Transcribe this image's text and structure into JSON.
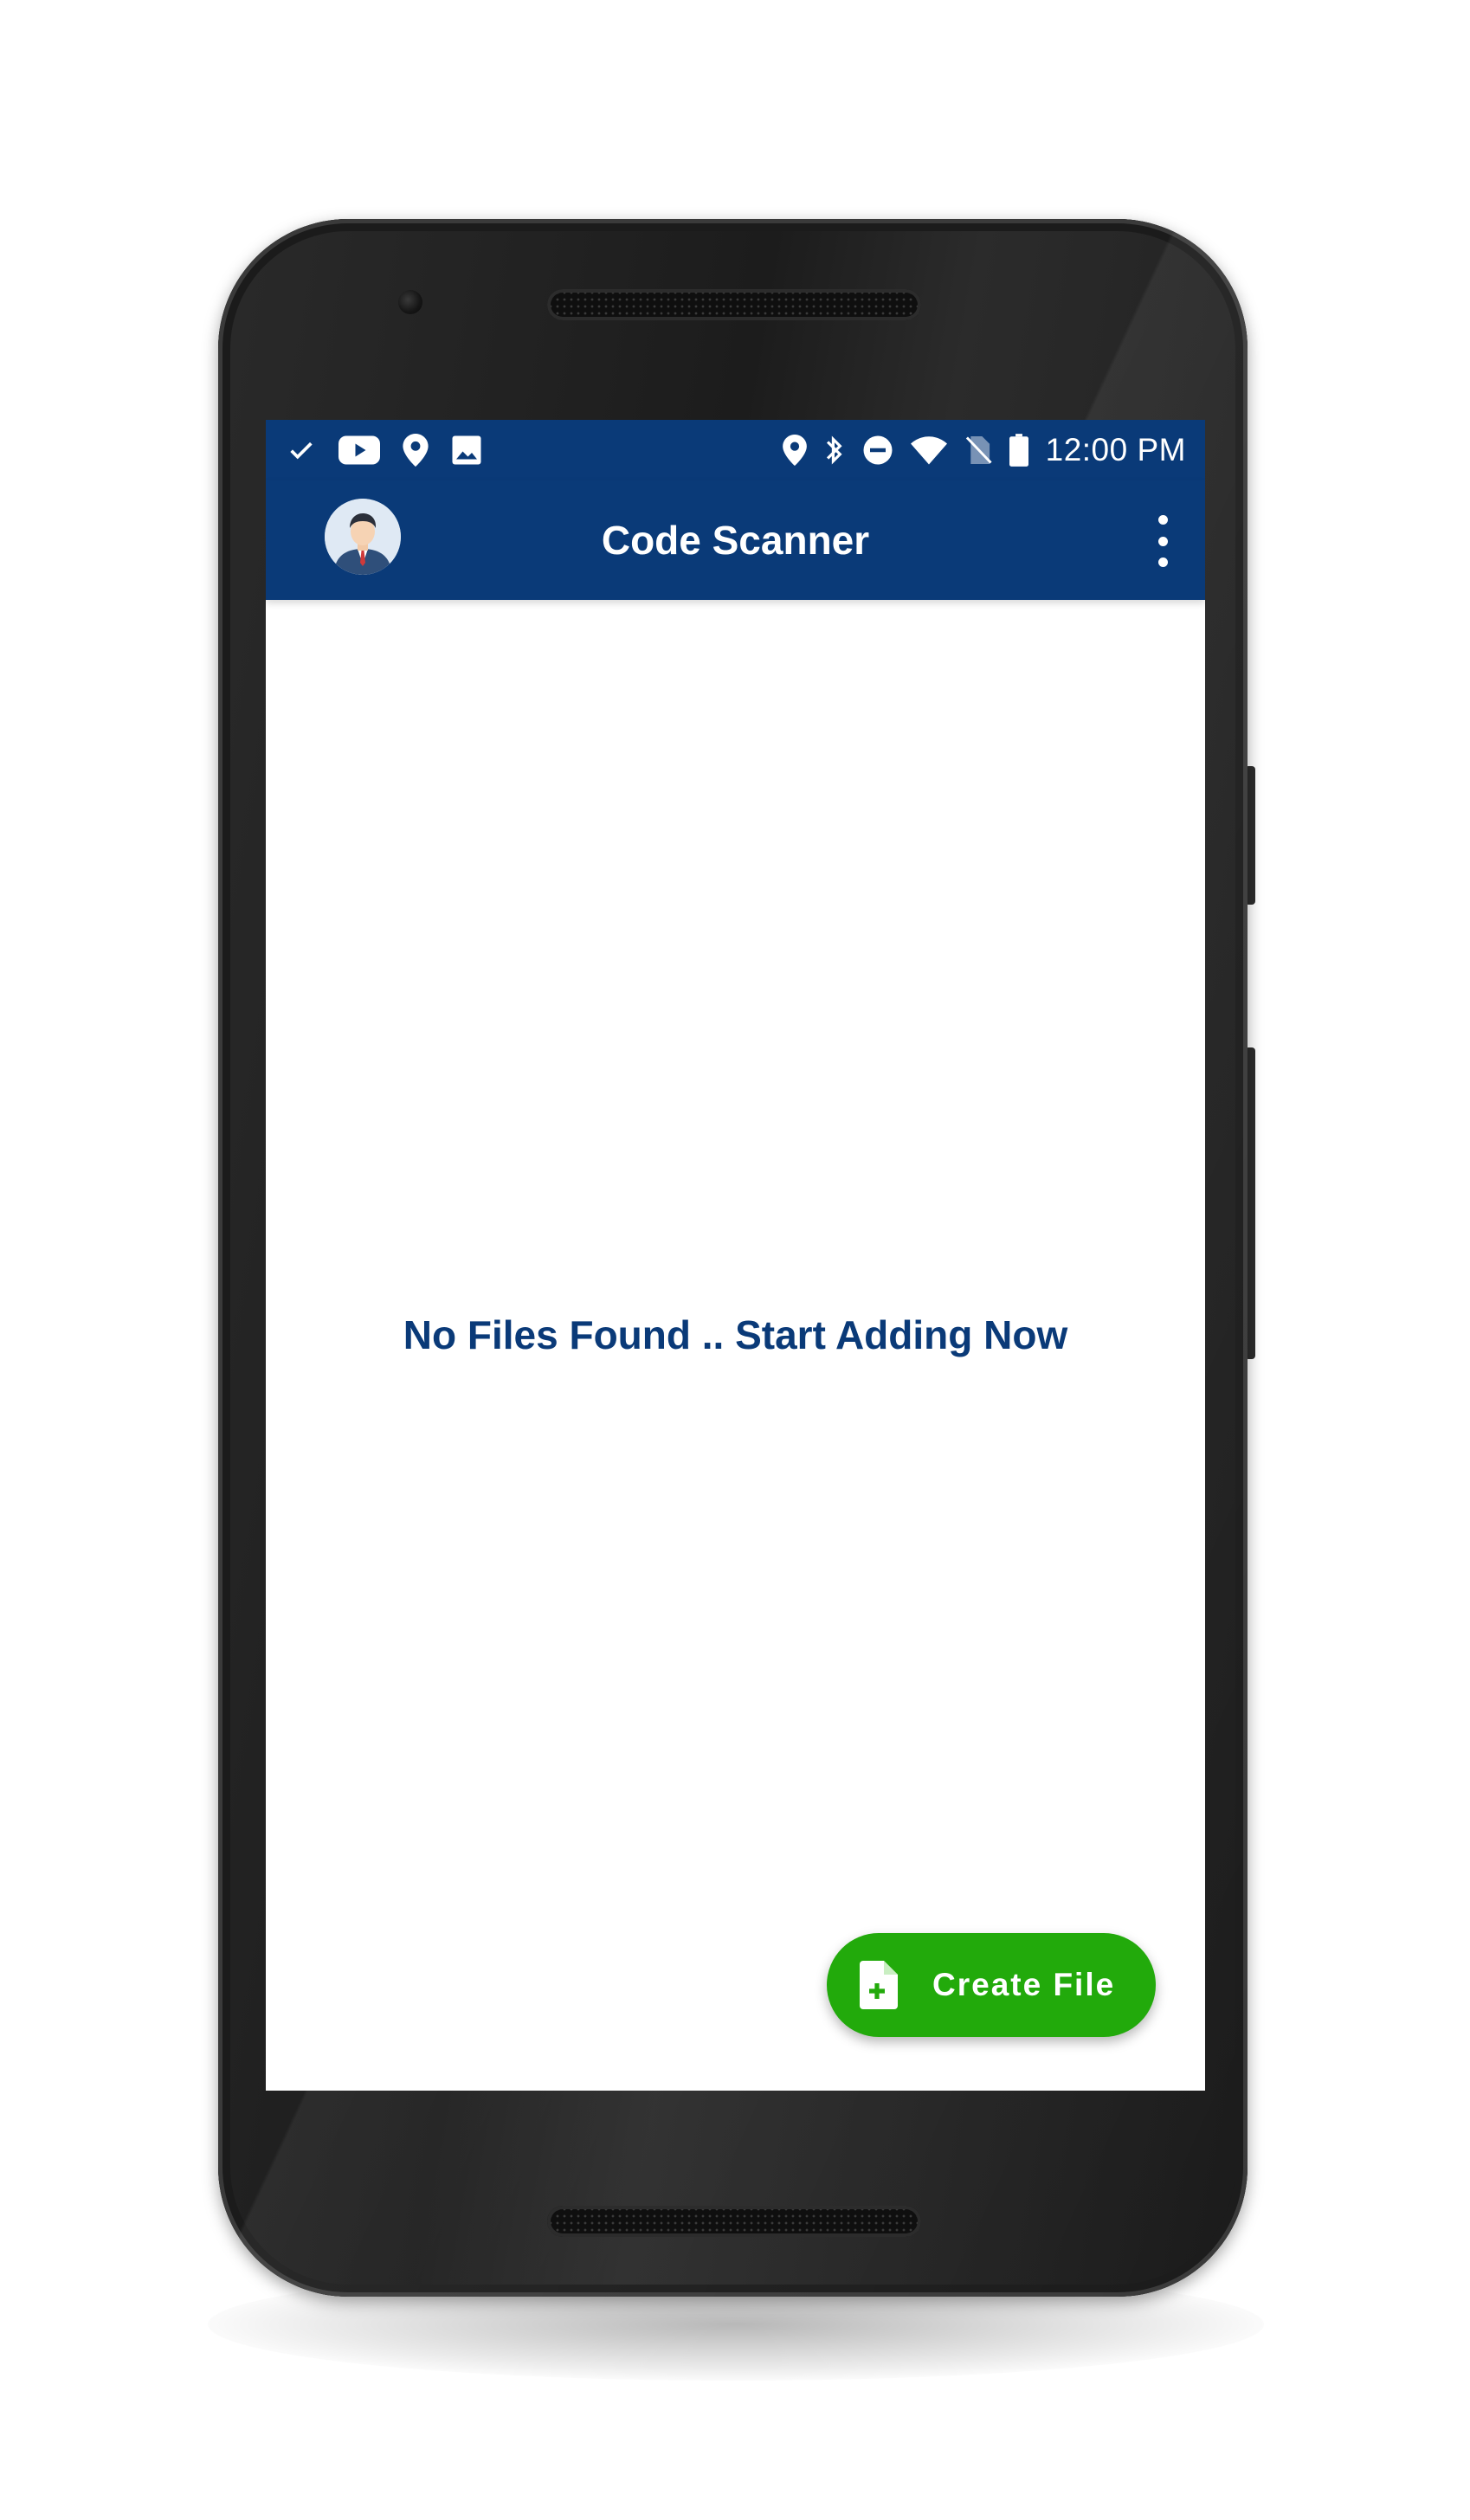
{
  "status_bar": {
    "time": "12:00 PM",
    "left_icons": [
      "check-icon",
      "youtube-icon",
      "location-pin-icon",
      "image-icon"
    ],
    "right_icons": [
      "location-pin-icon",
      "bluetooth-icon",
      "do-not-disturb-icon",
      "wifi-icon",
      "no-sim-icon",
      "battery-icon"
    ]
  },
  "app_bar": {
    "title": "Code Scanner",
    "avatar": "avatar-icon",
    "menu": "overflow-menu-icon"
  },
  "main": {
    "empty_message": "No Files Found .. Start Adding Now"
  },
  "fab": {
    "label": "Create File",
    "icon": "add-file-icon"
  },
  "colors": {
    "primary": "#0a3a78",
    "accent": "#22aa0b",
    "surface": "#ffffff"
  }
}
